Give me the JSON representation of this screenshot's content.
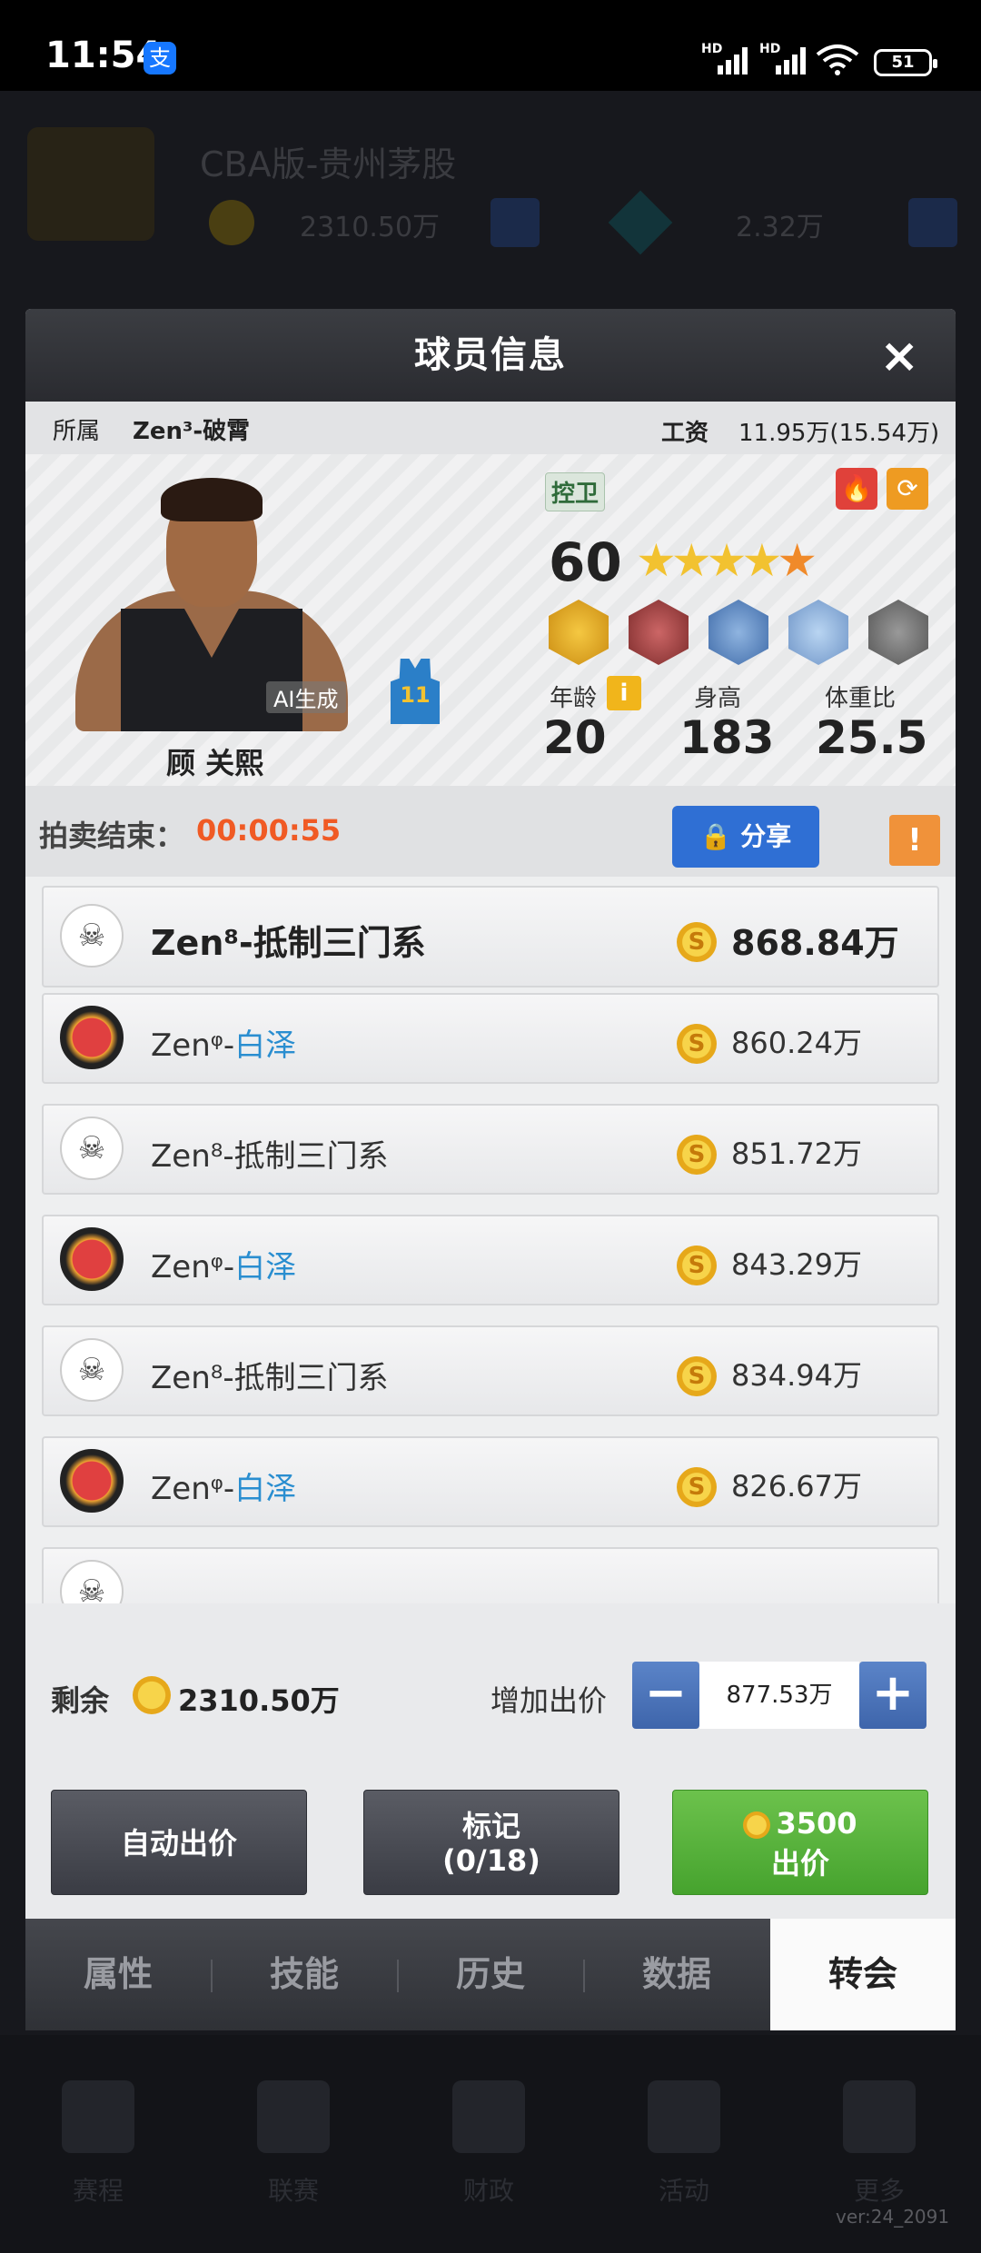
{
  "status_bar": {
    "time": "11:54",
    "app_icon": "支",
    "battery": "51",
    "signal1": "HD",
    "signal2": "HD"
  },
  "background": {
    "club_name": "CBA版-贵州茅股",
    "cash": "2310.50万",
    "gems": "2.32万",
    "footer_labels": [
      "赛程",
      "联赛",
      "财政",
      "活动",
      "更多"
    ]
  },
  "version": "ver:24_2091",
  "modal": {
    "title": "球员信息",
    "close_icon": "×",
    "team_label": "所属",
    "team_name": "Zen³-破霄",
    "salary_label": "工资",
    "salary_value": "11.95万(15.54万)",
    "player": {
      "name": "顾 关熙",
      "ai_badge": "AI生成",
      "jersey_number": "11",
      "position": "控卫",
      "rating": "60",
      "stars": "★★★★★",
      "age_label": "年龄",
      "age": "20",
      "height_label": "身高",
      "height": "183",
      "weight_label": "体重比",
      "weight": "25.5",
      "info_icon": "i"
    },
    "auction": {
      "label": "拍卖结束：",
      "countdown": "00:00:55",
      "share_label": "分享",
      "warn_icon": "!"
    },
    "bids": [
      {
        "team_prefix": "Zen⁸-",
        "team_suffix": "抵制三门系",
        "highlight": false,
        "amount": "868.84万",
        "avatar": "white"
      },
      {
        "team_prefix": "Zenᵠ-",
        "team_suffix": "白泽",
        "highlight": true,
        "amount": "860.24万",
        "avatar": "red"
      },
      {
        "team_prefix": "Zen⁸-",
        "team_suffix": "抵制三门系",
        "highlight": false,
        "amount": "851.72万",
        "avatar": "white"
      },
      {
        "team_prefix": "Zenᵠ-",
        "team_suffix": "白泽",
        "highlight": true,
        "amount": "843.29万",
        "avatar": "red"
      },
      {
        "team_prefix": "Zen⁸-",
        "team_suffix": "抵制三门系",
        "highlight": false,
        "amount": "834.94万",
        "avatar": "white"
      },
      {
        "team_prefix": "Zenᵠ-",
        "team_suffix": "白泽",
        "highlight": true,
        "amount": "826.67万",
        "avatar": "red"
      }
    ],
    "remaining_label": "剩余",
    "remaining_value": "2310.50万",
    "increase_label": "增加出价",
    "increase_value": "877.53万",
    "buttons": {
      "auto_bid": "自动出价",
      "mark_line1": "标记",
      "mark_line2": "(0/18)",
      "bid_amount": "3500",
      "bid_label": "出价"
    },
    "tabs": [
      "属性",
      "技能",
      "历史",
      "数据",
      "转会"
    ],
    "selected_tab": "转会"
  },
  "colors": {
    "accent_orange": "#f05a24",
    "share_blue": "#2f6fd4",
    "bid_green": "#46a32e",
    "team_blue": "#2a8ed0"
  }
}
